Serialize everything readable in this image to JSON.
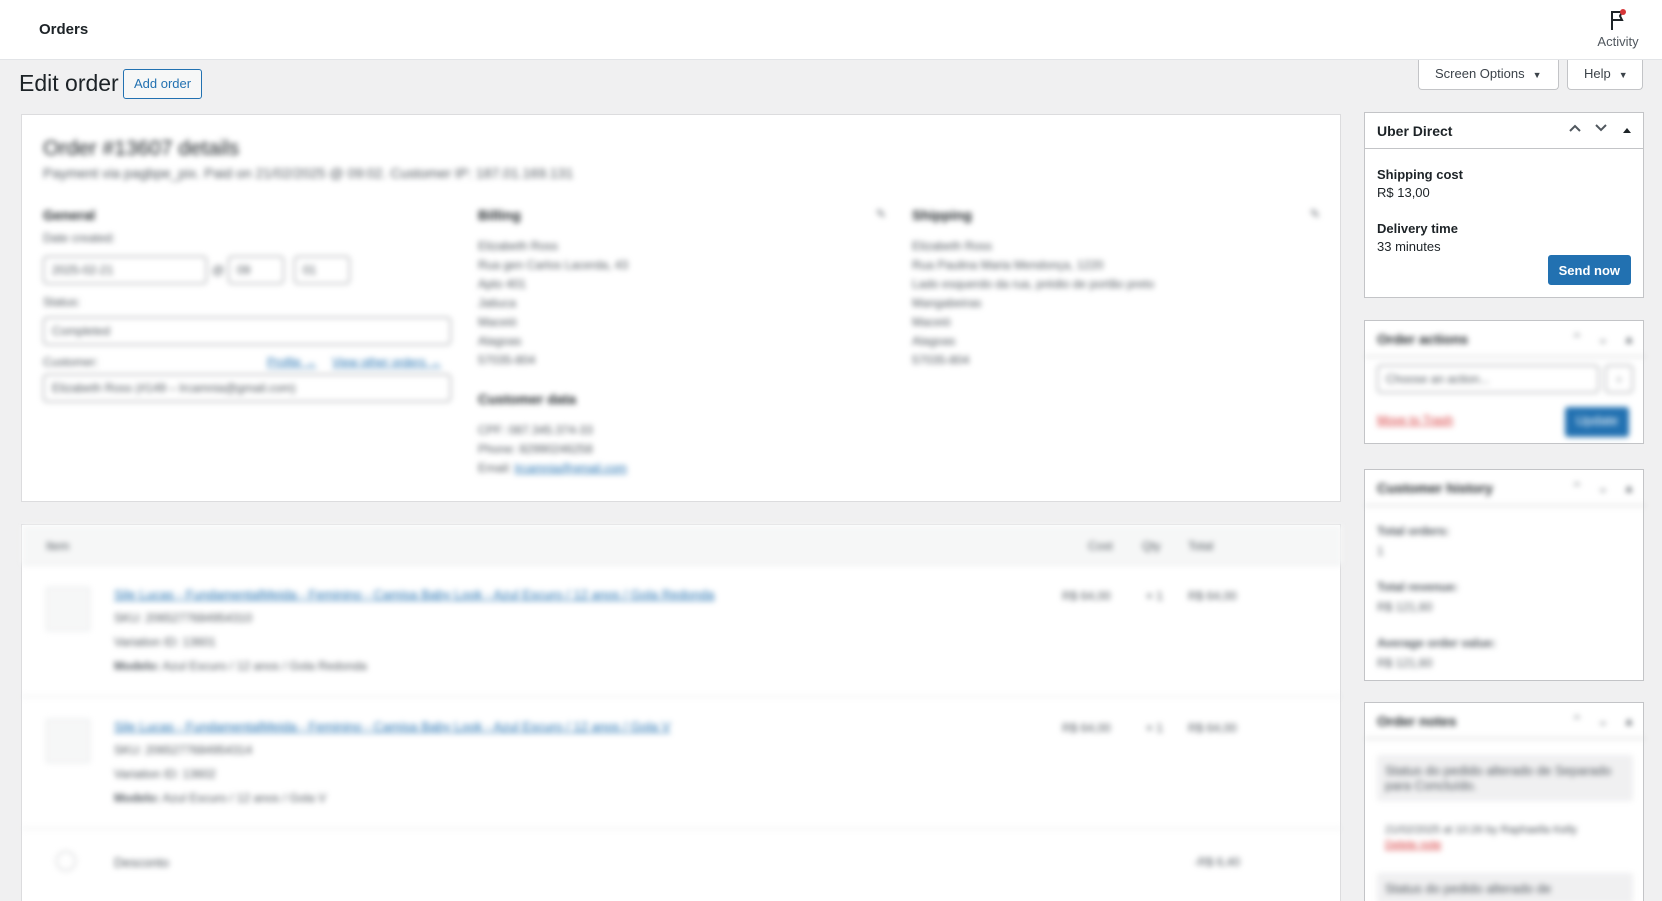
{
  "topbar": {
    "title": "Orders",
    "activity_label": "Activity"
  },
  "page": {
    "title": "Edit order",
    "add_order": "Add order"
  },
  "screen_options": {
    "screen_options_label": "Screen Options",
    "help_label": "Help"
  },
  "order": {
    "heading": "Order #13607 details",
    "subheading": "Payment via pagbpe_pix. Paid on 21/02/2025 @ 09:02. Customer IP: 187.01.169.131",
    "general_label": "General",
    "date_created_label": "Date created:",
    "date_value": "2025-02-21",
    "hour_value": "09",
    "minute_value": "01",
    "status_label": "Status:",
    "status_value": "Completed",
    "customer_label": "Customer:",
    "profile_link": "Profile →",
    "view_orders_link": "View other orders →",
    "customer_value": "Elizabeth Ross (#149 – lrcamnia@gmail.com)",
    "billing_label": "Billing",
    "billing_lines": [
      "Elizabeth Ross",
      "Rua gen Carlos Lacerda, 43",
      "Apto 401",
      "Jatiuca",
      "Maceió",
      "Alagoas",
      "57035-804"
    ],
    "shipping_label": "Shipping",
    "shipping_lines": [
      "Elizabeth Ross",
      "Rua Paulina Maria Mendonça, 1220",
      "Lado esquerdo da rua, prédio de portão preto",
      "Mangabeiras",
      "Maceió",
      "Alagoas",
      "57035-804"
    ],
    "customer_data_label": "Customer data",
    "cpf_line": "CPF: 087.345.374-33",
    "phone_line": "Phone: 82990246258",
    "email_prefix": "Email:",
    "email_value": "lrcamnia@gmail.com"
  },
  "items": {
    "col_item": "Item",
    "col_cost": "Cost",
    "col_qty": "Qty",
    "col_total": "Total",
    "rows": [
      {
        "name": "Sile Lucas - FundamentalMeida - Feminino - Camisa Baby Look - Azul Escuro / 12 anos / Gola Redonda",
        "sku": "SKU: 2065277684954310",
        "variation": "Variation ID: 13601",
        "model_label": "Modelo:",
        "model": "Azul Escuro / 12 anos / Gola Redonda",
        "cost": "R$ 64,00",
        "qty": "× 1",
        "total": "R$ 64,00"
      },
      {
        "name": "Sile Lucas - FundamentalMeida - Feminino - Camisa Baby Look - Azul Escuro / 12 anos / Gola V",
        "sku": "SKU: 2065277684954314",
        "variation": "Variation ID: 13602",
        "model_label": "Modelo:",
        "model": "Azul Escuro / 12 anos / Gola V",
        "cost": "R$ 64,00",
        "qty": "× 1",
        "total": "R$ 64,00"
      }
    ],
    "discount_label": "Desconto",
    "discount_value": "-R$ 6,40"
  },
  "uber": {
    "title": "Uber Direct",
    "shipping_cost_label": "Shipping cost",
    "shipping_cost_value": "R$ 13,00",
    "delivery_time_label": "Delivery time",
    "delivery_time_value": "33 minutes",
    "send_now": "Send now"
  },
  "order_actions": {
    "title": "Order actions",
    "select_value": "Choose an action...",
    "trash": "Move to Trash",
    "update": "Update"
  },
  "customer_history": {
    "title": "Customer history",
    "total_orders_label": "Total orders:",
    "total_orders_value": "1",
    "total_revenue_label": "Total revenue:",
    "total_revenue_value": "R$ 121,60",
    "avg_label": "Average order value:",
    "avg_value": "R$ 121,60"
  },
  "order_notes": {
    "title": "Order notes",
    "note1": "Status do pedido alterado de Separado para Concluído.",
    "note1_meta": "21/02/2025 at 10:26 by Raphaella Kelly",
    "delete": "Delete note",
    "note2": "Status do pedido alterado de"
  },
  "colors": {
    "accent": "#2271b1",
    "danger": "#d63638"
  }
}
